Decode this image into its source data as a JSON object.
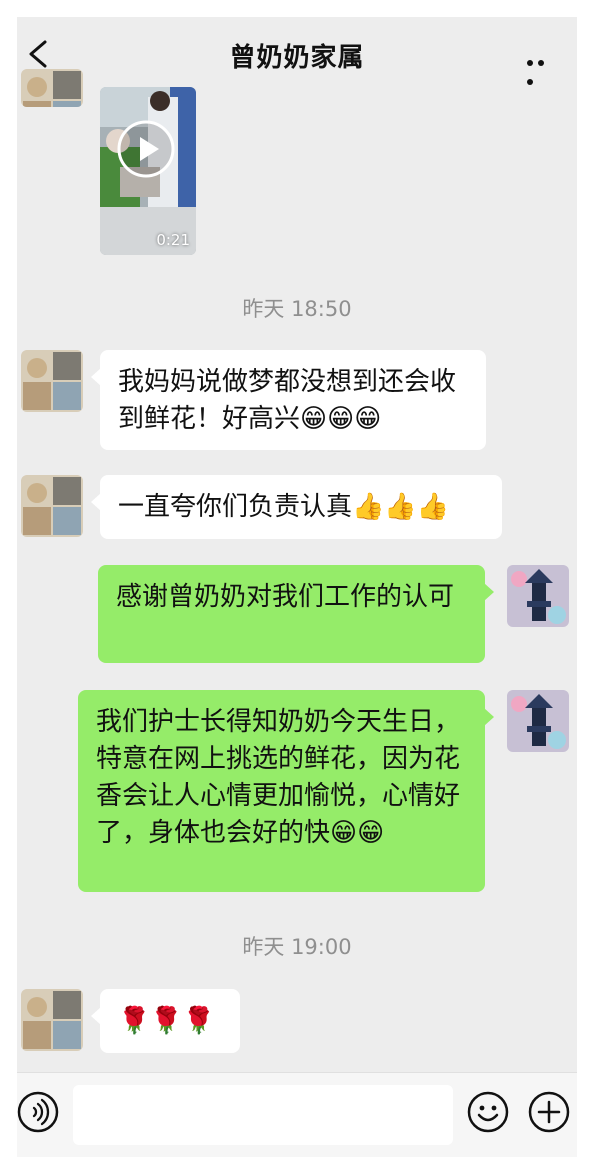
{
  "header": {
    "title": "曾奶奶家属",
    "back_icon": "chevron-left-icon",
    "more_icon": "more-dots-icon"
  },
  "video": {
    "duration": "0:21"
  },
  "messages": [
    {
      "type": "time",
      "text": "昨天 18:50"
    },
    {
      "type": "left",
      "text": "我妈妈说做梦都没想到还会收到鲜花！好高兴",
      "emojis": "😁😁😁"
    },
    {
      "type": "left",
      "text": "一直夸你们负责认真",
      "emojis": "👍👍👍"
    },
    {
      "type": "right",
      "text": "感谢曾奶奶对我们工作的认可"
    },
    {
      "type": "right",
      "text": "我们护士长得知奶奶今天生日，特意在网上挑选的鲜花，因为花香会让人心情更加愉悦，心情好了，身体也会好的快",
      "emojis": "😁😁"
    },
    {
      "type": "time",
      "text": "昨天 19:00"
    },
    {
      "type": "left",
      "text": "",
      "emojis": "🌹🌹🌹"
    }
  ],
  "input": {
    "value": "",
    "placeholder": ""
  },
  "colors": {
    "background": "#ededed",
    "bubble_right": "#95ec69",
    "bubble_left": "#ffffff"
  }
}
